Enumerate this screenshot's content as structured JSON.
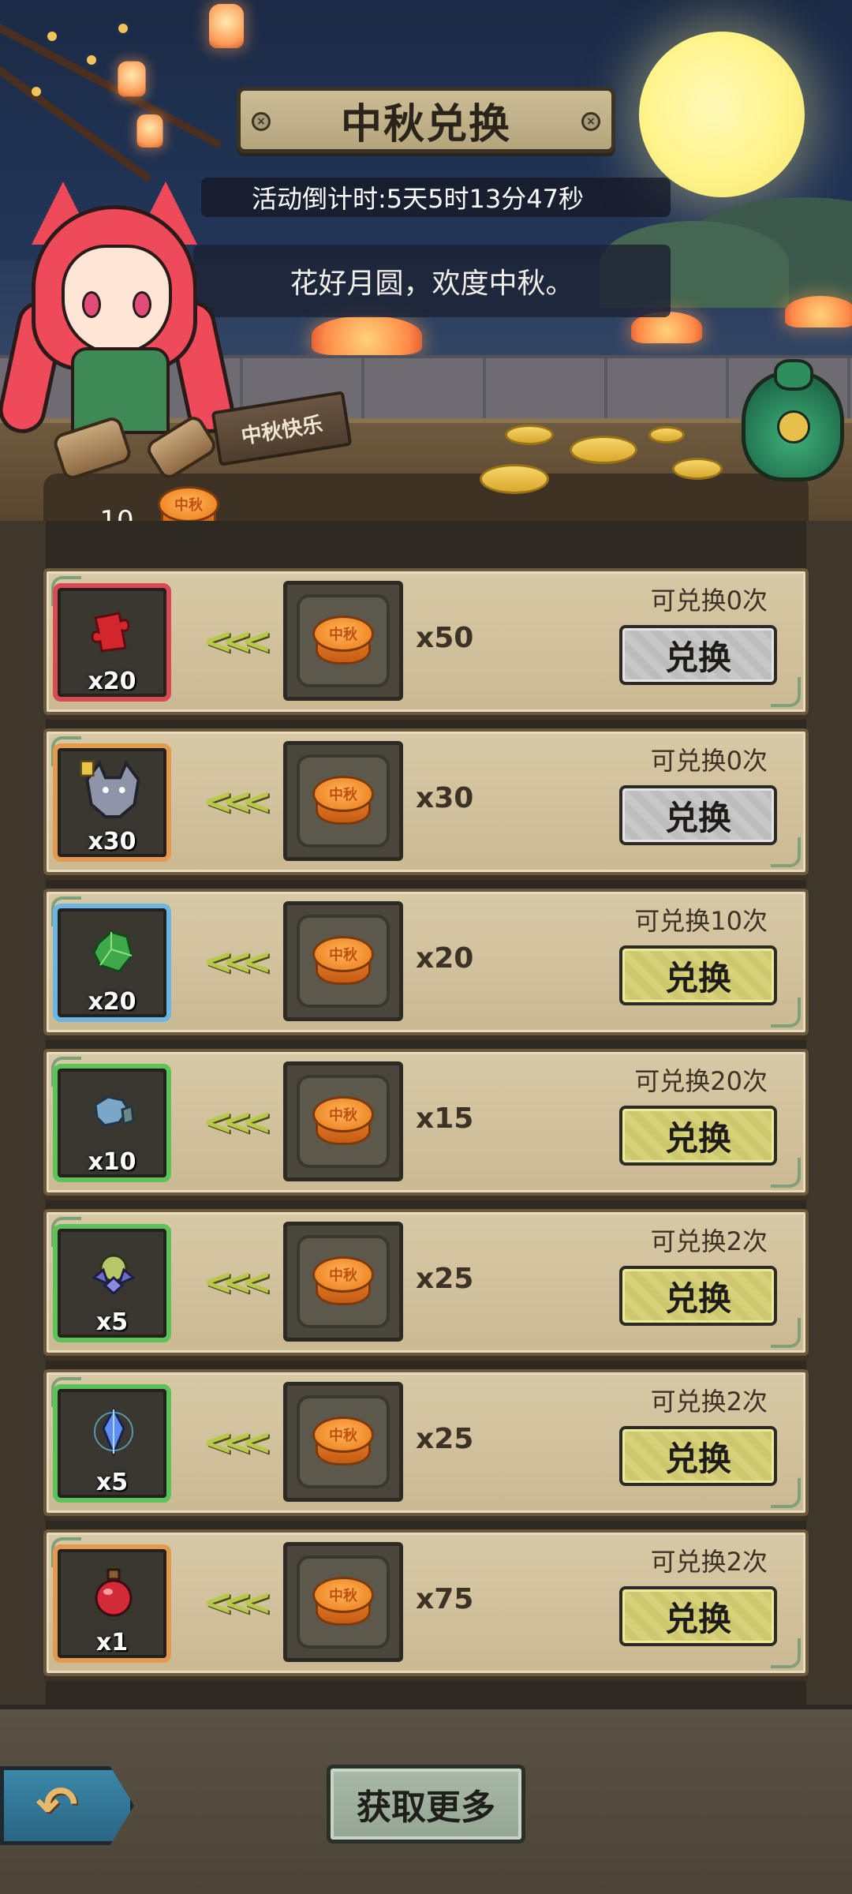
{
  "header": {
    "title": "中秋兑换",
    "countdown": "活动倒计时:5天5时13分47秒",
    "dialogue": "花好月圆，欢度中秋。",
    "sign_text": "中秋快乐"
  },
  "currency": {
    "count": "10",
    "icon": "mooncake-icon",
    "icon_label": "中秋"
  },
  "exchange_items": [
    {
      "reward_icon": "red-puzzle-piece-icon",
      "reward_qty": "x20",
      "rarity": "red",
      "cost_qty": "x50",
      "remaining": "可兑换0次",
      "button": "兑换",
      "enabled": false
    },
    {
      "reward_icon": "wolf-character-icon",
      "reward_qty": "x30",
      "rarity": "orange",
      "cost_qty": "x30",
      "remaining": "可兑换0次",
      "button": "兑换",
      "enabled": false
    },
    {
      "reward_icon": "green-gem-icon",
      "reward_qty": "x20",
      "rarity": "blue",
      "cost_qty": "x20",
      "remaining": "可兑换10次",
      "button": "兑换",
      "enabled": true
    },
    {
      "reward_icon": "blue-ore-icon",
      "reward_qty": "x10",
      "rarity": "green",
      "cost_qty": "x15",
      "remaining": "可兑换20次",
      "button": "兑换",
      "enabled": true
    },
    {
      "reward_icon": "crystal-cluster-icon",
      "reward_qty": "x5",
      "rarity": "green",
      "cost_qty": "x25",
      "remaining": "可兑换2次",
      "button": "兑换",
      "enabled": true
    },
    {
      "reward_icon": "blue-crystal-icon",
      "reward_qty": "x5",
      "rarity": "green",
      "cost_qty": "x25",
      "remaining": "可兑换2次",
      "button": "兑换",
      "enabled": true
    },
    {
      "reward_icon": "red-potion-icon",
      "reward_qty": "x1",
      "rarity": "orange",
      "cost_qty": "x75",
      "remaining": "可兑换2次",
      "button": "兑换",
      "enabled": true
    }
  ],
  "footer": {
    "back_icon": "back-arrow-icon",
    "more_label": "获取更多"
  },
  "colors": {
    "rarity_red": "#d94a55",
    "rarity_orange": "#e39a4e",
    "rarity_blue": "#6cb6e6",
    "rarity_green": "#5cc35a",
    "button_active": "#d7d27a",
    "button_disabled": "#c8c8c8"
  }
}
